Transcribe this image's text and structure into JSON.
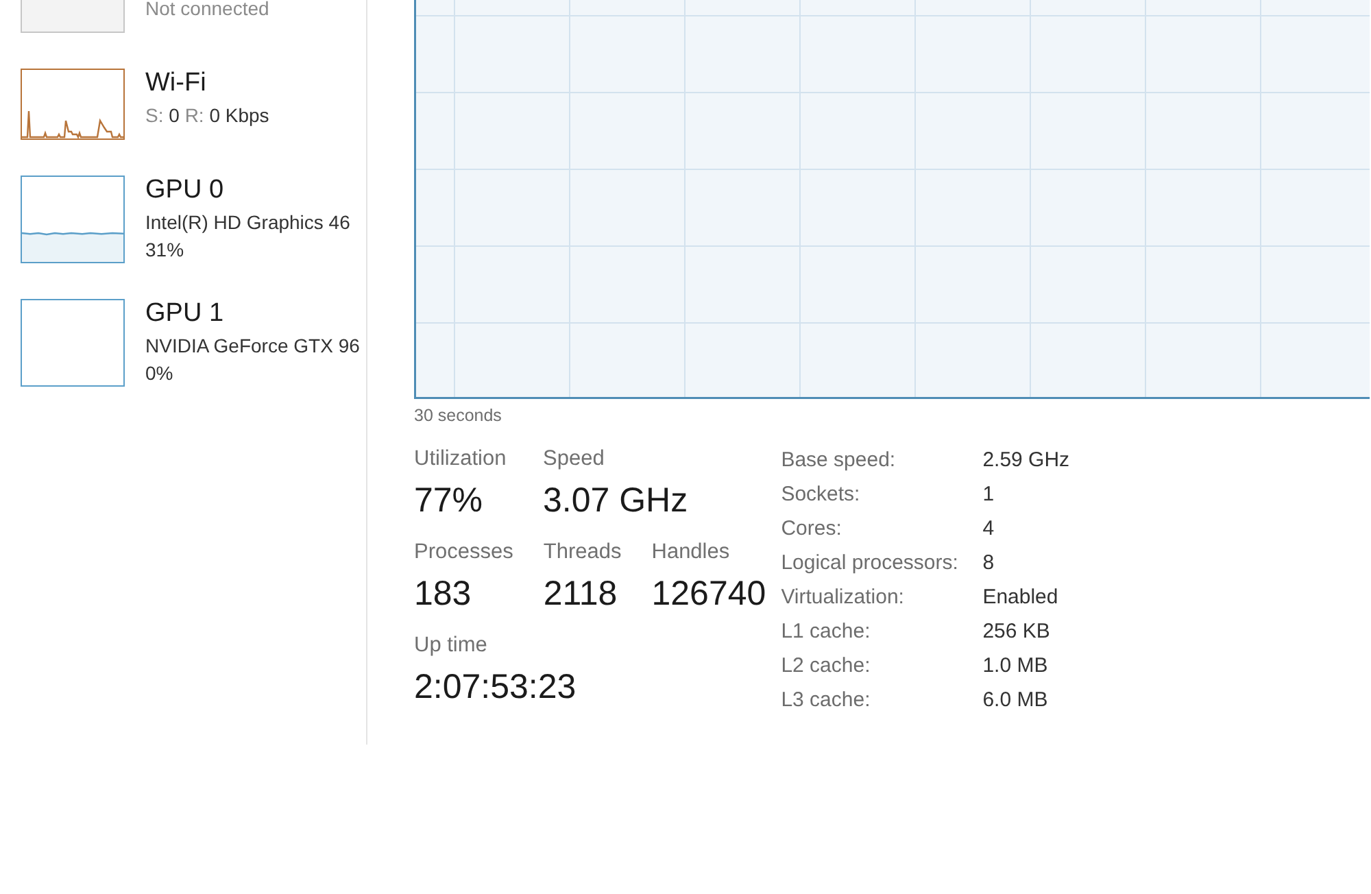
{
  "sidebar": {
    "items": [
      {
        "kind": "disconnected",
        "color": "#c6c6c6",
        "lines": [
          [
            {
              "kind": "label",
              "text": "Not connected"
            }
          ]
        ]
      },
      {
        "kind": "spikes",
        "color": "#b8743a",
        "title": "Wi-Fi",
        "lines": [
          [
            {
              "kind": "label",
              "text": "S:"
            },
            {
              "kind": "value",
              "text": "0"
            },
            {
              "kind": "label",
              "text": "R:"
            },
            {
              "kind": "value",
              "text": "0 Kbps"
            }
          ]
        ]
      },
      {
        "kind": "steady",
        "color": "#5b9fc9",
        "title": "GPU 0",
        "lines": [
          [
            {
              "kind": "value",
              "text": "Intel(R) HD Graphics 46"
            }
          ],
          [
            {
              "kind": "value",
              "text": "31%"
            }
          ]
        ]
      },
      {
        "kind": "idle",
        "color": "#5b9fc9",
        "title": "GPU 1",
        "lines": [
          [
            {
              "kind": "value",
              "text": "NVIDIA GeForce GTX 96"
            }
          ],
          [
            {
              "kind": "value",
              "text": "0%"
            }
          ]
        ]
      }
    ]
  },
  "graph": {
    "time_span": "30 seconds"
  },
  "stat_rows": [
    {
      "stats": [
        {
          "label": "Utilization",
          "value": "77%"
        },
        {
          "label": "Speed",
          "value": "3.07 GHz"
        }
      ]
    },
    {
      "stats": [
        {
          "label": "Processes",
          "value": "183"
        },
        {
          "label": "Threads",
          "value": "2118"
        },
        {
          "label": "Handles",
          "value": "126740"
        }
      ]
    },
    {
      "stats": [
        {
          "label": "Up time",
          "value": "2:07:53:23"
        }
      ]
    }
  ],
  "details": [
    {
      "label": "Base speed:",
      "value": "2.59 GHz"
    },
    {
      "label": "Sockets:",
      "value": "1"
    },
    {
      "label": "Cores:",
      "value": "4"
    },
    {
      "label": "Logical processors:",
      "value": "8"
    },
    {
      "label": "Virtualization:",
      "value": "Enabled"
    },
    {
      "label": "L1 cache:",
      "value": "256 KB"
    },
    {
      "label": "L2 cache:",
      "value": "1.0 MB"
    },
    {
      "label": "L3 cache:",
      "value": "6.0 MB"
    }
  ]
}
